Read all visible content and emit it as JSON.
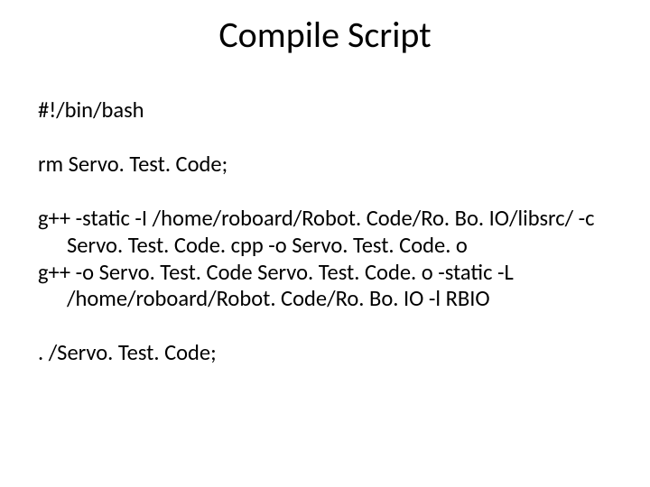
{
  "title": "Compile Script",
  "lines": {
    "shebang": "#!/bin/bash",
    "rm": "rm Servo. Test. Code;",
    "gpp1": "g++ -static -I /home/roboard/Robot. Code/Ro. Bo. IO/libsrc/ -c Servo. Test. Code. cpp -o Servo. Test. Code. o",
    "gpp2": "g++ -o Servo. Test. Code Servo. Test. Code. o -static -L /home/roboard/Robot. Code/Ro. Bo. IO -l RBIO",
    "run": ". /Servo. Test. Code;"
  }
}
